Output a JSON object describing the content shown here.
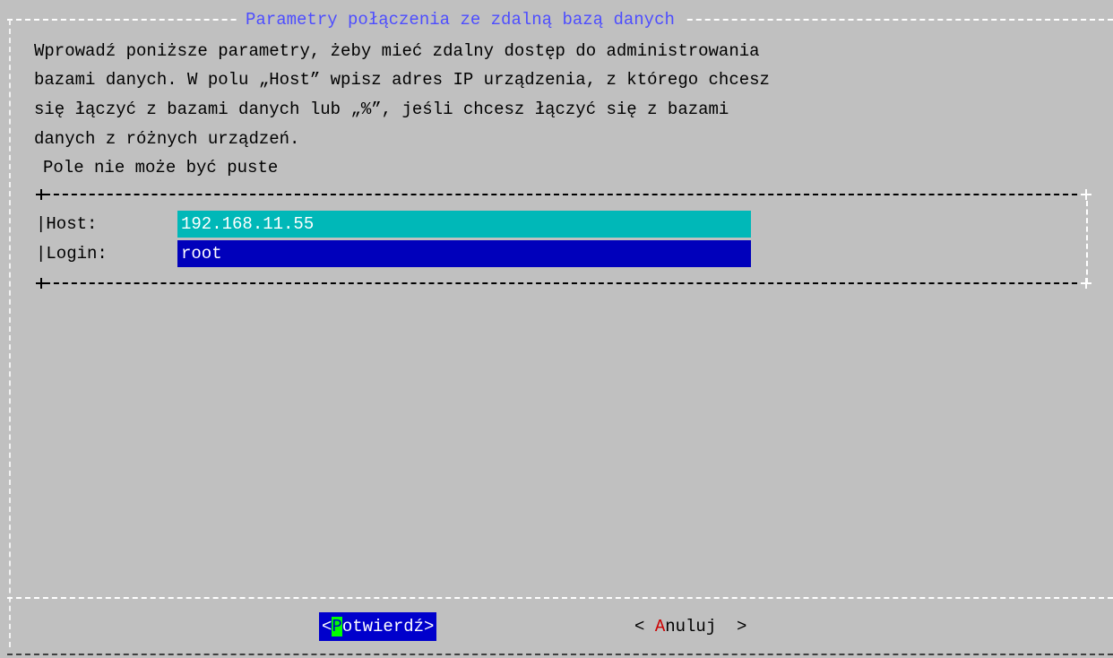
{
  "dialog": {
    "title": "Parametry połączenia ze zdalną bazą danych",
    "description_lines": [
      "Wprowadź poniższe parametry, żeby mieć zdalny dostęp do administrowania",
      "bazami danych. W polu „Host” wpisz adres IP urządzenia, z którego chcesz",
      "się łączyć z bazami danych lub „%”, jeśli chcesz łączyć się z bazami",
      "danych z różnych urządzeń."
    ],
    "warning": "Pole nie może być puste"
  },
  "form": {
    "host": {
      "label": "|Host:",
      "value": "192.168.11.55"
    },
    "login": {
      "label": "|Login:",
      "value": "root"
    }
  },
  "buttons": {
    "confirm": {
      "open": "<",
      "hotkey": "P",
      "rest": "otwierdź",
      "close": ">"
    },
    "cancel": {
      "open": "< ",
      "hotkey": "A",
      "rest": "nuluj",
      "close": "  >"
    }
  },
  "colors": {
    "background": "#c0c0c0",
    "title": "#4d4dff",
    "host_field": "#00b8b8",
    "login_field": "#0000bb",
    "confirm_button": "#0000cc",
    "confirm_hotkey": "#00ff00",
    "cancel_hotkey": "#cc0000"
  }
}
